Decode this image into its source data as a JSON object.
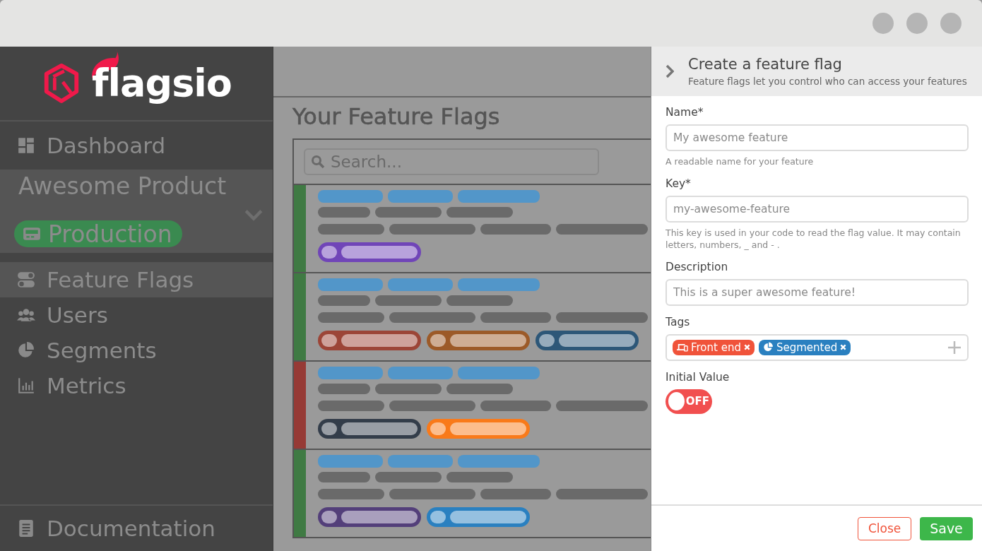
{
  "brand": {
    "name": "flagsio"
  },
  "sidebar": {
    "items": [
      {
        "label": "Dashboard",
        "kind": "dashboard",
        "selected": false
      }
    ],
    "project": {
      "name": "Awesome Product",
      "environment": "Production"
    },
    "nav": [
      {
        "label": "Feature Flags",
        "kind": "toggles",
        "selected": true
      },
      {
        "label": "Users",
        "kind": "users",
        "selected": false
      },
      {
        "label": "Segments",
        "kind": "pie",
        "selected": false
      },
      {
        "label": "Metrics",
        "kind": "chart",
        "selected": false
      }
    ],
    "footer": {
      "label": "Documentation"
    }
  },
  "main": {
    "title": "Your Feature Flags",
    "search": {
      "placeholder": "Search..."
    },
    "rows": [
      {
        "color": "#3f7a43",
        "tags": [
          {
            "color": "#7045b8"
          }
        ]
      },
      {
        "color": "#3f7a43",
        "tags": [
          {
            "color": "#9c4537"
          },
          {
            "color": "#9c5a28"
          },
          {
            "color": "#2d5778"
          }
        ]
      },
      {
        "color": "#963a35",
        "tags": [
          {
            "color": "#333d4a"
          },
          {
            "color": "#f97a1a"
          }
        ]
      },
      {
        "color": "#3f7a43",
        "tags": [
          {
            "color": "#533f7a"
          },
          {
            "color": "#2a80c0"
          }
        ]
      }
    ]
  },
  "drawer": {
    "title": "Create a feature flag",
    "subtitle": "Feature flags let you control who can access your features",
    "fields": [
      {
        "label": "Name*",
        "placeholder": "My awesome feature",
        "hint": "A readable name for your feature"
      },
      {
        "label": "Key*",
        "placeholder": "my-awesome-feature",
        "hint": "This key is used in your code to read the flag value. It may contain letters, numbers, _ and - ."
      },
      {
        "label": "Description",
        "placeholder": "This is a super awesome feature!"
      }
    ],
    "tags": {
      "label": "Tags",
      "items": [
        {
          "label": "Front end",
          "kind": "devices",
          "color": "#f0533a"
        },
        {
          "label": "Segmented",
          "kind": "pie",
          "color": "#2a80c0"
        }
      ]
    },
    "initial_value": {
      "label": "Initial Value",
      "on": false,
      "text": "OFF"
    },
    "buttons": [
      {
        "label": "Close",
        "kind": "secondary"
      },
      {
        "label": "Save",
        "kind": "primary"
      }
    ]
  }
}
